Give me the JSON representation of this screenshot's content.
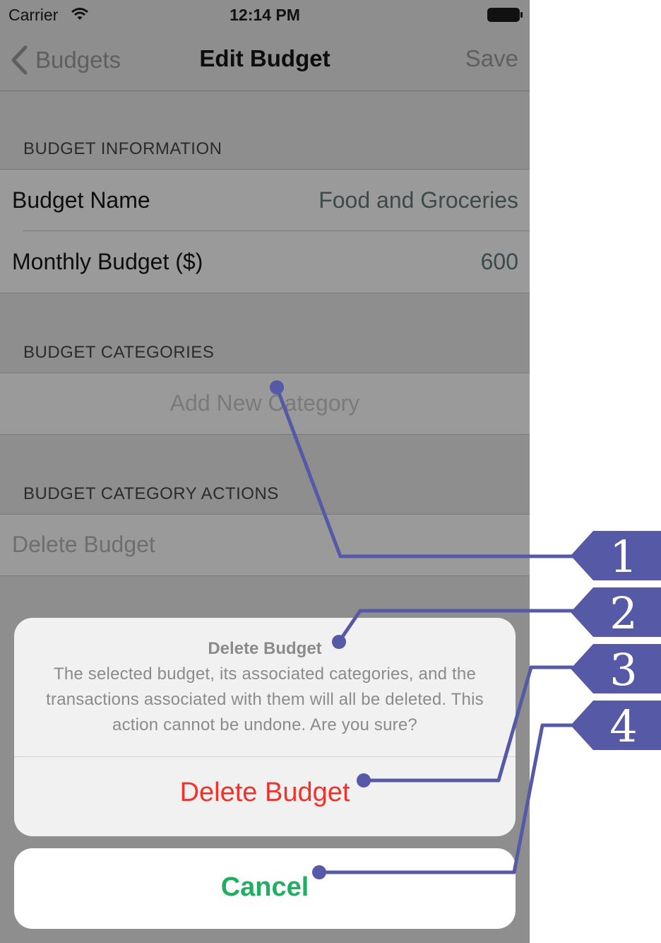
{
  "status_bar": {
    "carrier": "Carrier",
    "time": "12:14 PM"
  },
  "nav": {
    "back_label": "Budgets",
    "title": "Edit Budget",
    "save_label": "Save"
  },
  "sections": {
    "info_header": "BUDGET INFORMATION",
    "categories_header": "BUDGET CATEGORIES",
    "actions_header": "BUDGET CATEGORY ACTIONS"
  },
  "fields": {
    "name_label": "Budget Name",
    "name_value": "Food and Groceries",
    "monthly_label": "Monthly Budget ($)",
    "monthly_value": "600"
  },
  "categories": {
    "add_label": "Add New Category"
  },
  "actions": {
    "delete_label": "Delete Budget"
  },
  "action_sheet": {
    "title": "Delete Budget",
    "message": "The selected budget, its associated categories, and the transactions associated with them will all be deleted. This action cannot be undone. Are you sure?",
    "destructive_label": "Delete Budget",
    "cancel_label": "Cancel"
  },
  "callouts": [
    "1",
    "2",
    "3",
    "4"
  ],
  "colors": {
    "callout": "#5559a6",
    "destructive": "#f0322b",
    "cancel": "#1fae62",
    "dim_overlay": "#8e8e8e"
  }
}
